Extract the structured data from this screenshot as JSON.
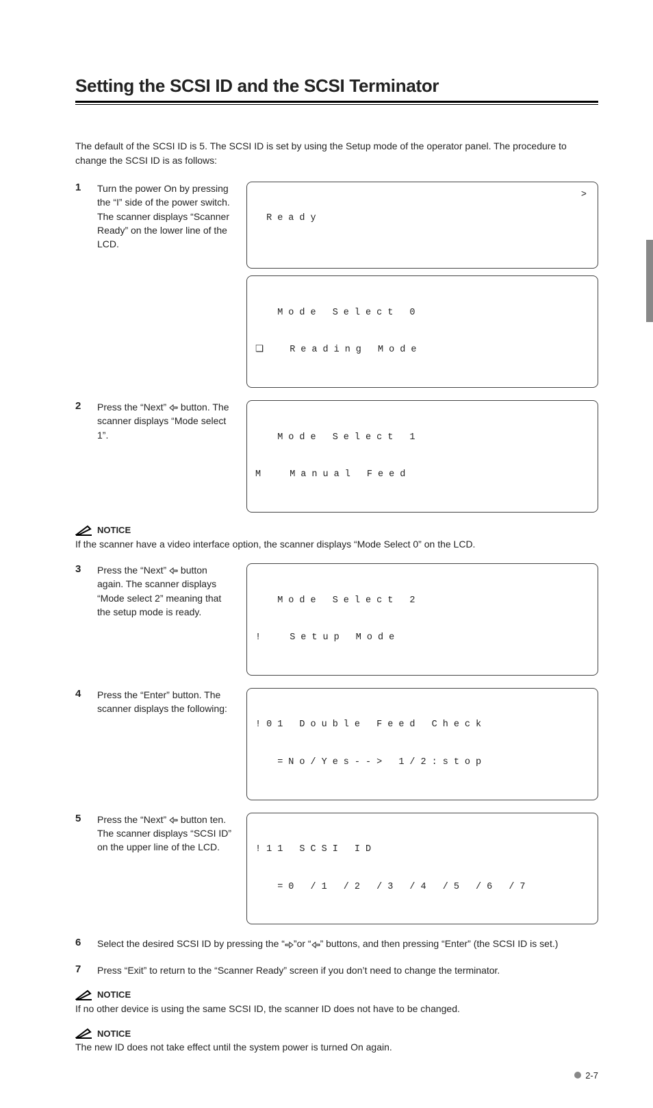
{
  "title": "Setting the SCSI ID and the SCSI Terminator",
  "intro": "The default of the SCSI ID is 5. The SCSI ID is set by using the Setup mode of the operator panel. The procedure to change the SCSI ID is as follows:",
  "steps": {
    "s1": {
      "num": "1",
      "text": "Turn the power On by pressing the “I” side of the power switch. The scanner displays “Scanner Ready” on the lower line of the LCD.",
      "lcd1_line1": " Ready",
      "lcd1_chevron": ">",
      "lcd2_line1": "  Mode Select 0",
      "lcd2_prefix_icon": "❏",
      "lcd2_line2": "  Reading Mode"
    },
    "s2": {
      "num": "2",
      "text_a": "Press the “Next” ",
      "text_b": " button. The scanner displays “Mode select 1”.",
      "lcd_line1": "  Mode Select 1",
      "lcd_prefix": "M",
      "lcd_line2": "  Manual Feed"
    },
    "s3": {
      "num": "3",
      "text_a": "Press the “Next” ",
      "text_b": " button again. The scanner displays “Mode select 2” meaning that the setup mode is ready.",
      "lcd_line1": "  Mode Select 2",
      "lcd_prefix": "!",
      "lcd_line2": "  Setup Mode"
    },
    "s4": {
      "num": "4",
      "text": "Press the “Enter” button. The scanner displays the following:",
      "lcd_line1": "!01 Double Feed Check",
      "lcd_line2": "  =No/Yes--> 1/2:stop"
    },
    "s5": {
      "num": "5",
      "text_a": "Press the “Next” ",
      "text_b": " button ten. The scanner displays “SCSI ID” on the upper line of the LCD.",
      "lcd_line1": "!11 SCSI ID",
      "lcd_line2": "  =0 /1 /2 /3 /4 /5 /6 /7"
    },
    "s6": {
      "num": "6",
      "text_a": "Select the desired SCSI ID by pressing the “",
      "text_b": "”or “",
      "text_c": "” buttons, and then pressing “Enter” (the SCSI ID is set.)"
    },
    "s7": {
      "num": "7",
      "text": "Press “Exit” to return to the “Scanner Ready” screen if you don’t need to change the terminator."
    }
  },
  "notices": {
    "label": "NOTICE",
    "n1": "If the scanner have a video interface option, the scanner displays “Mode Select 0” on the LCD.",
    "n2": "If no other device is using the same SCSI ID, the scanner ID does not have to be changed.",
    "n3": "The new ID does not take effect until the system power is turned On again."
  },
  "footer": "2-7"
}
